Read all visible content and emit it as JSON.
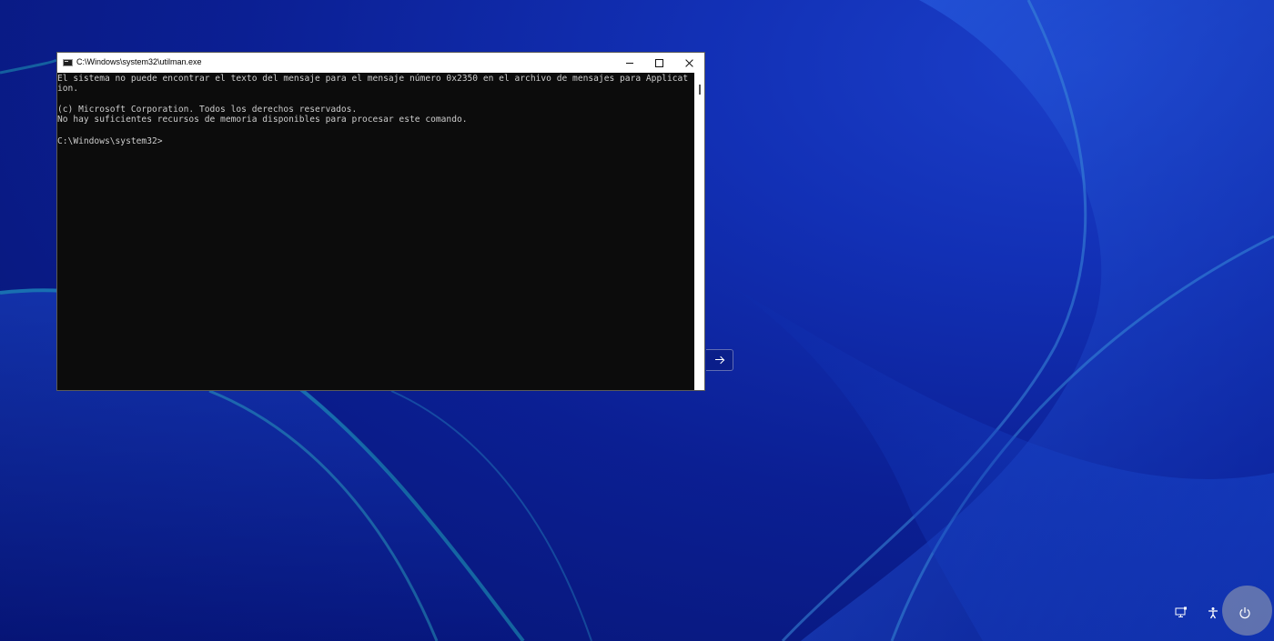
{
  "window": {
    "title": "C:\\Windows\\system32\\utilman.exe",
    "controls": {
      "minimize": "minimize",
      "maximize": "maximize",
      "close": "close"
    }
  },
  "console": {
    "lines": [
      "El sistema no puede encontrar el texto del mensaje para el mensaje número 0x2350 en el archivo de mensajes para Applicat",
      "ion.",
      "",
      "(c) Microsoft Corporation. Todos los derechos reservados.",
      "No hay suficientes recursos de memoria disponibles para procesar este comando.",
      "",
      "C:\\Windows\\system32>"
    ]
  },
  "colors": {
    "console_bg": "#0c0c0c",
    "console_text": "#cccccc",
    "desktop_blue": "#1230b5"
  },
  "icons": {
    "submit": "arrow-right-icon",
    "network": "network-icon",
    "accessibility": "accessibility-icon",
    "power": "power-icon"
  }
}
